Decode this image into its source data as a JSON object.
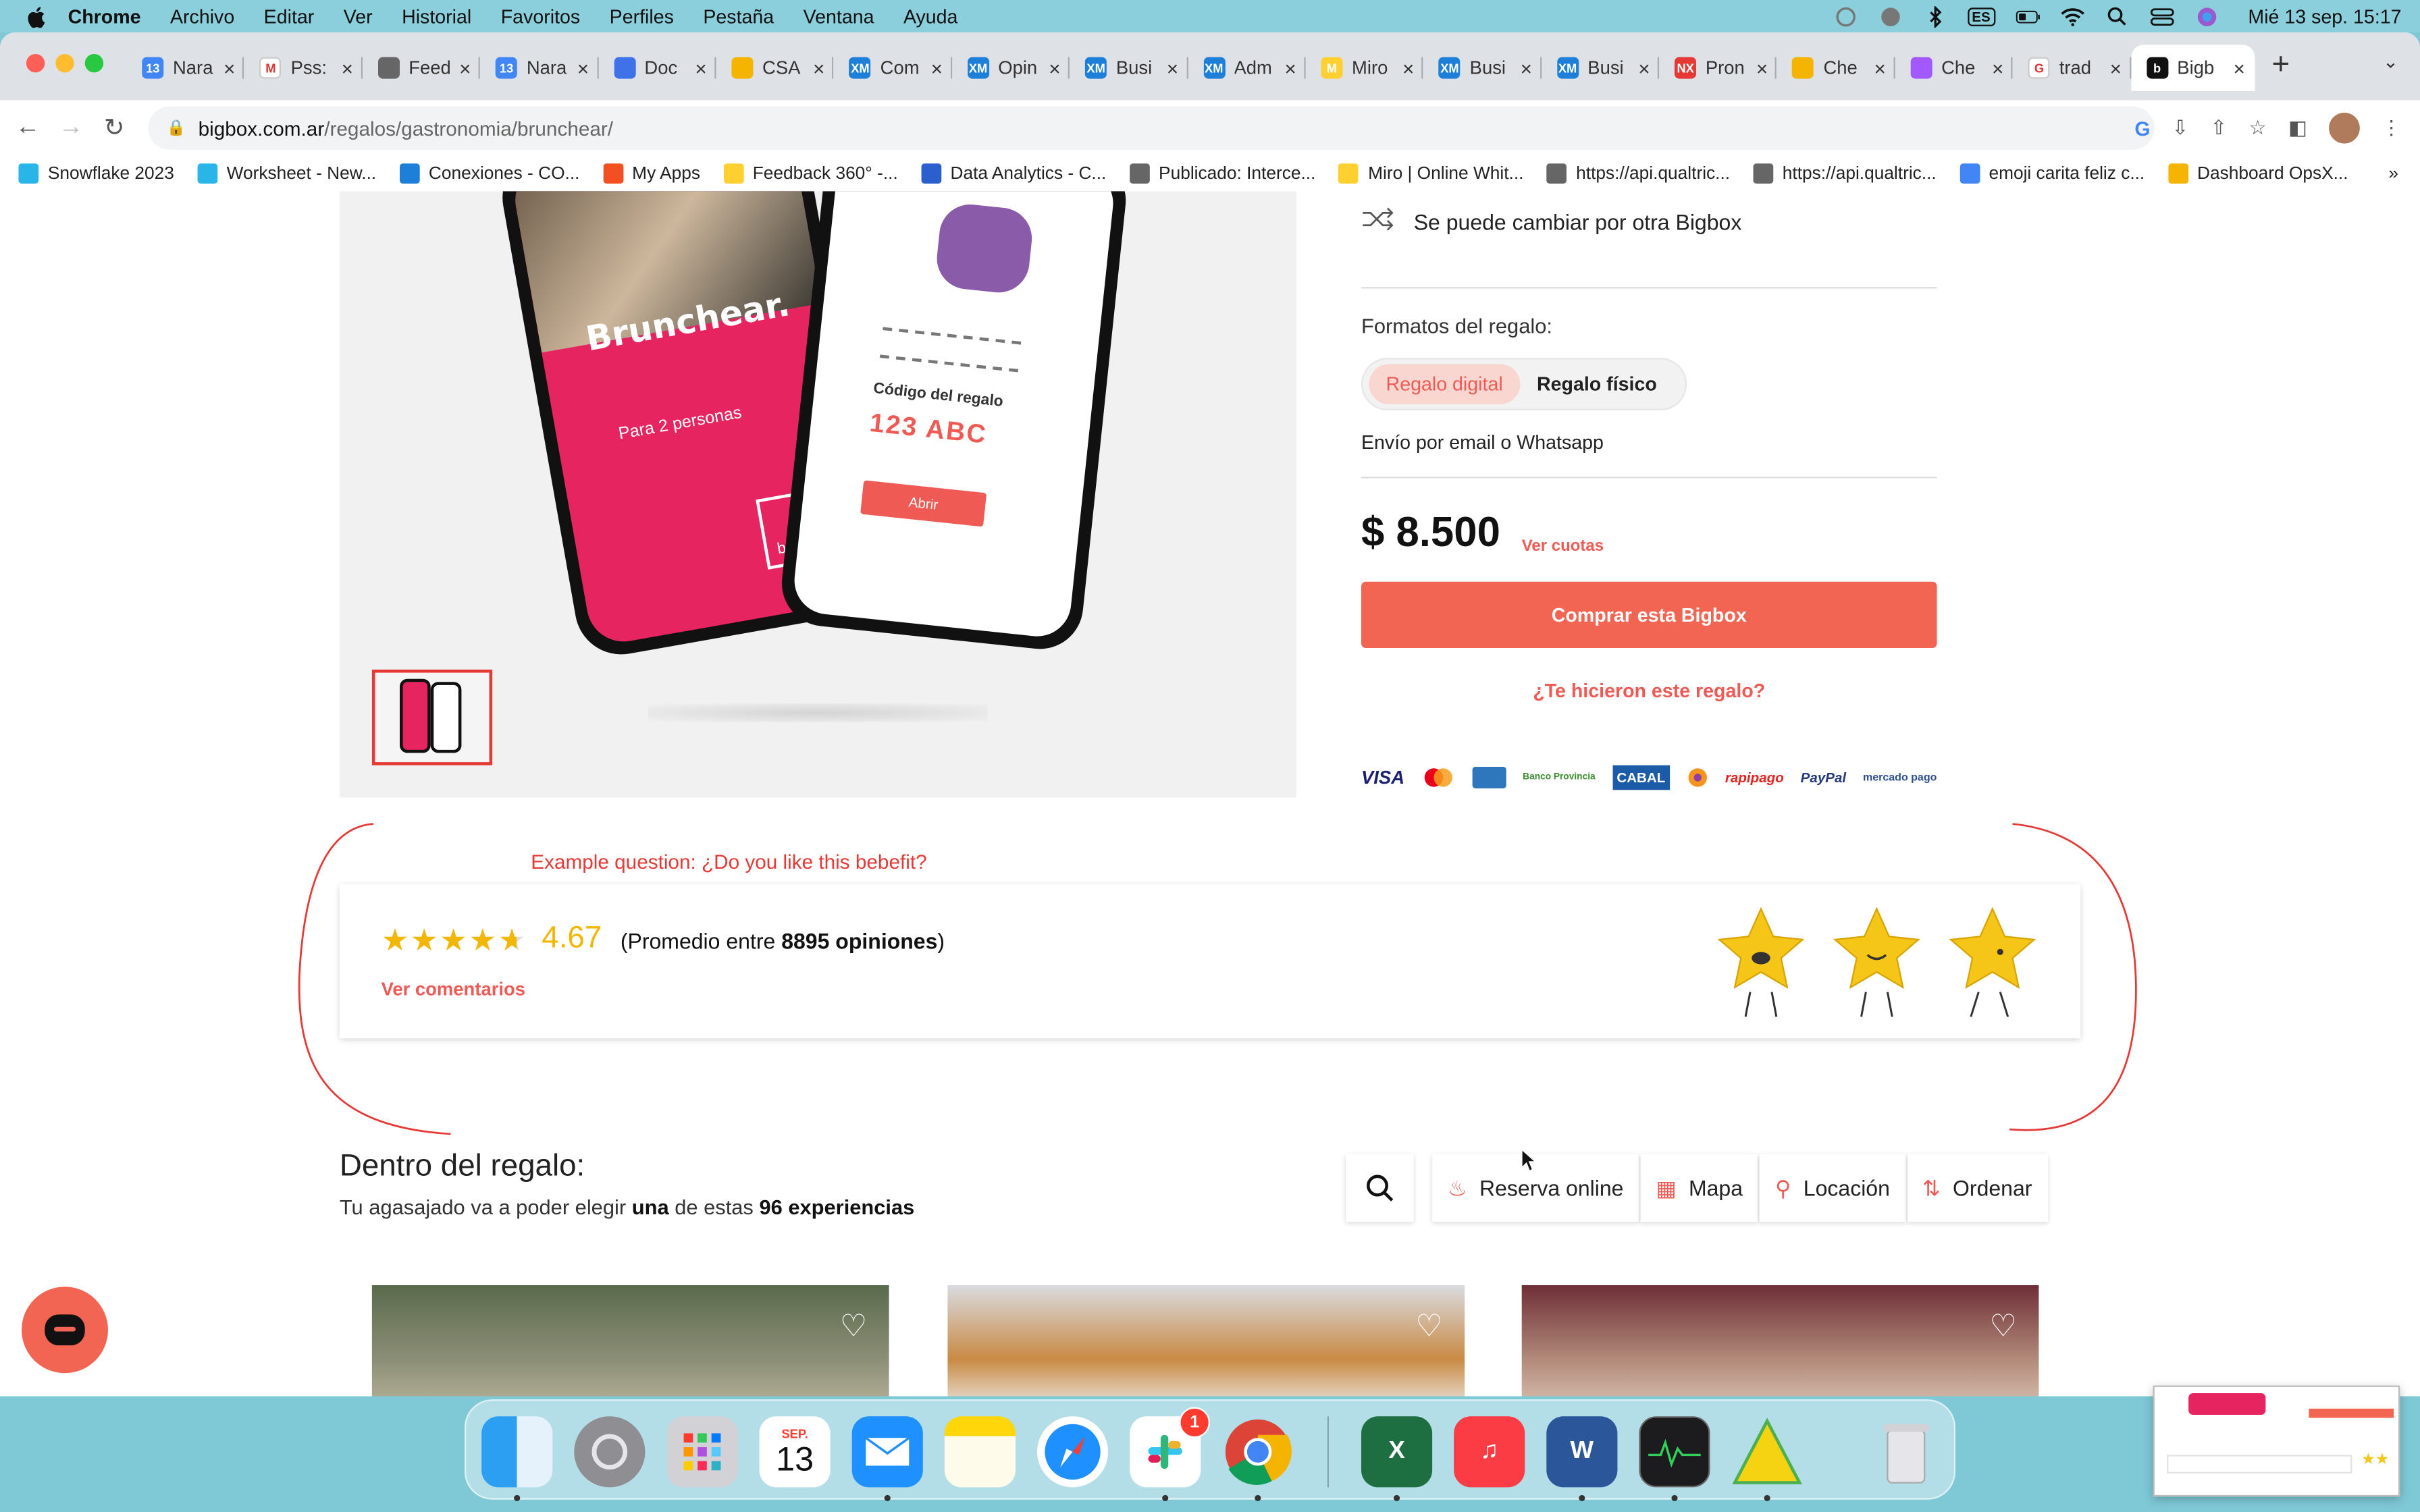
{
  "menubar": {
    "app": "Chrome",
    "items": [
      "Archivo",
      "Editar",
      "Ver",
      "Historial",
      "Favoritos",
      "Perfiles",
      "Pestaña",
      "Ventana",
      "Ayuda"
    ],
    "input_lang": "ES",
    "clock": "Mié 13 sep.  15:17"
  },
  "tabs": [
    {
      "title": "Nara",
      "fav_color": "#4285f4",
      "fav_text": "13"
    },
    {
      "title": "Pss:",
      "fav_color": "#ffffff",
      "fav_text": "M"
    },
    {
      "title": "Feed",
      "fav_color": "#666666",
      "fav_text": ""
    },
    {
      "title": "Nara",
      "fav_color": "#4285f4",
      "fav_text": "13"
    },
    {
      "title": "Doc",
      "fav_color": "#3f72e8",
      "fav_text": ""
    },
    {
      "title": "CSA",
      "fav_color": "#f4b400",
      "fav_text": ""
    },
    {
      "title": "Com",
      "fav_color": "#1e7fd8",
      "fav_text": "XM"
    },
    {
      "title": "Opin",
      "fav_color": "#1e7fd8",
      "fav_text": "XM"
    },
    {
      "title": "Busi",
      "fav_color": "#1e7fd8",
      "fav_text": "XM"
    },
    {
      "title": "Adm",
      "fav_color": "#1e7fd8",
      "fav_text": "XM"
    },
    {
      "title": "Miro",
      "fav_color": "#ffd02f",
      "fav_text": "M"
    },
    {
      "title": "Busi",
      "fav_color": "#1e7fd8",
      "fav_text": "XM"
    },
    {
      "title": "Busi",
      "fav_color": "#1e7fd8",
      "fav_text": "XM"
    },
    {
      "title": "Pron",
      "fav_color": "#e53935",
      "fav_text": "NX"
    },
    {
      "title": "Che",
      "fav_color": "#f4b400",
      "fav_text": ""
    },
    {
      "title": "Che",
      "fav_color": "#a259ff",
      "fav_text": ""
    },
    {
      "title": "trad",
      "fav_color": "#ffffff",
      "fav_text": "G"
    },
    {
      "title": "Bigb",
      "fav_color": "#111111",
      "fav_text": "b",
      "active": true
    }
  ],
  "url": {
    "host": "bigbox.com.ar",
    "path": "/regalos/gastronomia/brunchear/"
  },
  "bookmarks": [
    {
      "label": "Snowflake 2023",
      "color": "#29b5e8"
    },
    {
      "label": "Worksheet - New...",
      "color": "#29b5e8"
    },
    {
      "label": "Conexiones - CO...",
      "color": "#1e7fd8"
    },
    {
      "label": "My Apps",
      "color": "#f25022"
    },
    {
      "label": "Feedback 360° -...",
      "color": "#ffd02f"
    },
    {
      "label": "Data Analytics - C...",
      "color": "#2b5fce"
    },
    {
      "label": "Publicado: Interce...",
      "color": "#666666"
    },
    {
      "label": "Miro | Online Whit...",
      "color": "#ffd02f"
    },
    {
      "label": "https://api.qualtric...",
      "color": "#666666"
    },
    {
      "label": "https://api.qualtric...",
      "color": "#666666"
    },
    {
      "label": "emoji carita feliz c...",
      "color": "#4285f4"
    },
    {
      "label": "Dashboard OpsX...",
      "color": "#f4b400"
    }
  ],
  "product": {
    "phone_title": "Brunchear.",
    "phone_subtitle": "Para 2 personas",
    "phone_logo": "bigbox",
    "code_label": "Código del regalo",
    "code_value": "123 ABC",
    "open_label": "Abrir",
    "swap_text": "Se puede cambiar por otra Bigbox",
    "formats_label": "Formatos del regalo:",
    "format_digital": "Regalo digital",
    "format_physical": "Regalo físico",
    "shipping": "Envío por email o Whatsapp",
    "price": "$ 8.500",
    "installments": "Ver cuotas",
    "buy_button": "Comprar esta Bigbox",
    "gift_link": "¿Te hicieron este regalo?",
    "payments": [
      "VISA",
      "",
      "",
      "Banco Provincia",
      "CABAL",
      "",
      "rapipago",
      "PayPal",
      "mercado pago"
    ]
  },
  "rating": {
    "example_question": "Example question:  ¿Do you like this bebefit?",
    "stars_value": 4.67,
    "score": "4.67",
    "avg_prefix": "(Promedio entre ",
    "avg_count": "8895 opiniones",
    "avg_suffix": ")",
    "comments_link": "Ver comentarios"
  },
  "inside": {
    "title": "Dentro del regalo:",
    "sub_prefix": "Tu agasajado va a poder elegir ",
    "sub_bold1": "una",
    "sub_mid": " de estas ",
    "sub_bold2": "96 experiencias",
    "filters": [
      "Reserva online",
      "Mapa",
      "Locación",
      "Ordenar"
    ]
  },
  "dock": {
    "calendar_month": "SEP.",
    "calendar_day": "13",
    "slack_badge": "1"
  },
  "colors": {
    "accent": "#f26552",
    "link": "#ef5a55",
    "star": "#f2b705",
    "annotation": "#e53935"
  }
}
